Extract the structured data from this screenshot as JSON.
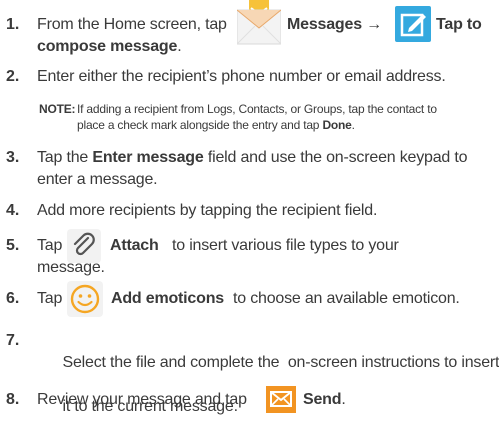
{
  "steps": [
    {
      "num": "1.",
      "pre": "From the Home screen, tap",
      "msg_label": "Messages",
      "arrow": "→",
      "compose_label": "Tap to",
      "compose_label2": "compose message",
      "end": "."
    },
    {
      "num": "2.",
      "text": "Enter either the recipient’s phone number or email address."
    },
    {
      "num": "3.",
      "pre": "Tap the",
      "bold": "Enter message",
      "post": "field and use the on-screen keypad to",
      "line2": "enter a message."
    },
    {
      "num": "4.",
      "text": "Add more recipients by tapping the recipient field."
    },
    {
      "num": "5.",
      "pre": "Tap",
      "bold": "Attach",
      "post": "to insert various file types to your",
      "line2": "message."
    },
    {
      "num": "6.",
      "pre": "Tap",
      "bold": "Add emoticons",
      "post": "to choose an available emoticon."
    },
    {
      "num": "7.",
      "line1": "Select the file and complete the  on-screen instructions to insert",
      "line2": "it to the current message."
    },
    {
      "num": "8.",
      "pre": "Review your message and tap",
      "bold": "Send",
      "end": "."
    }
  ],
  "note": {
    "label": "NOTE:",
    "line1": "If adding a recipient from Logs, Contacts, or Groups, tap the contact to",
    "line2_pre": "place a check mark alongside the entry and tap",
    "line2_bold": "Done",
    "line2_end": "."
  },
  "icons": [
    "messages-envelope-icon",
    "compose-pencil-icon",
    "paperclip-icon",
    "smiley-icon",
    "send-envelope-icon"
  ],
  "colors": {
    "text": "#3a3a3a",
    "compose_bg": "#34a9df",
    "send_bg": "#f29422",
    "smiley": "#f5a623"
  }
}
